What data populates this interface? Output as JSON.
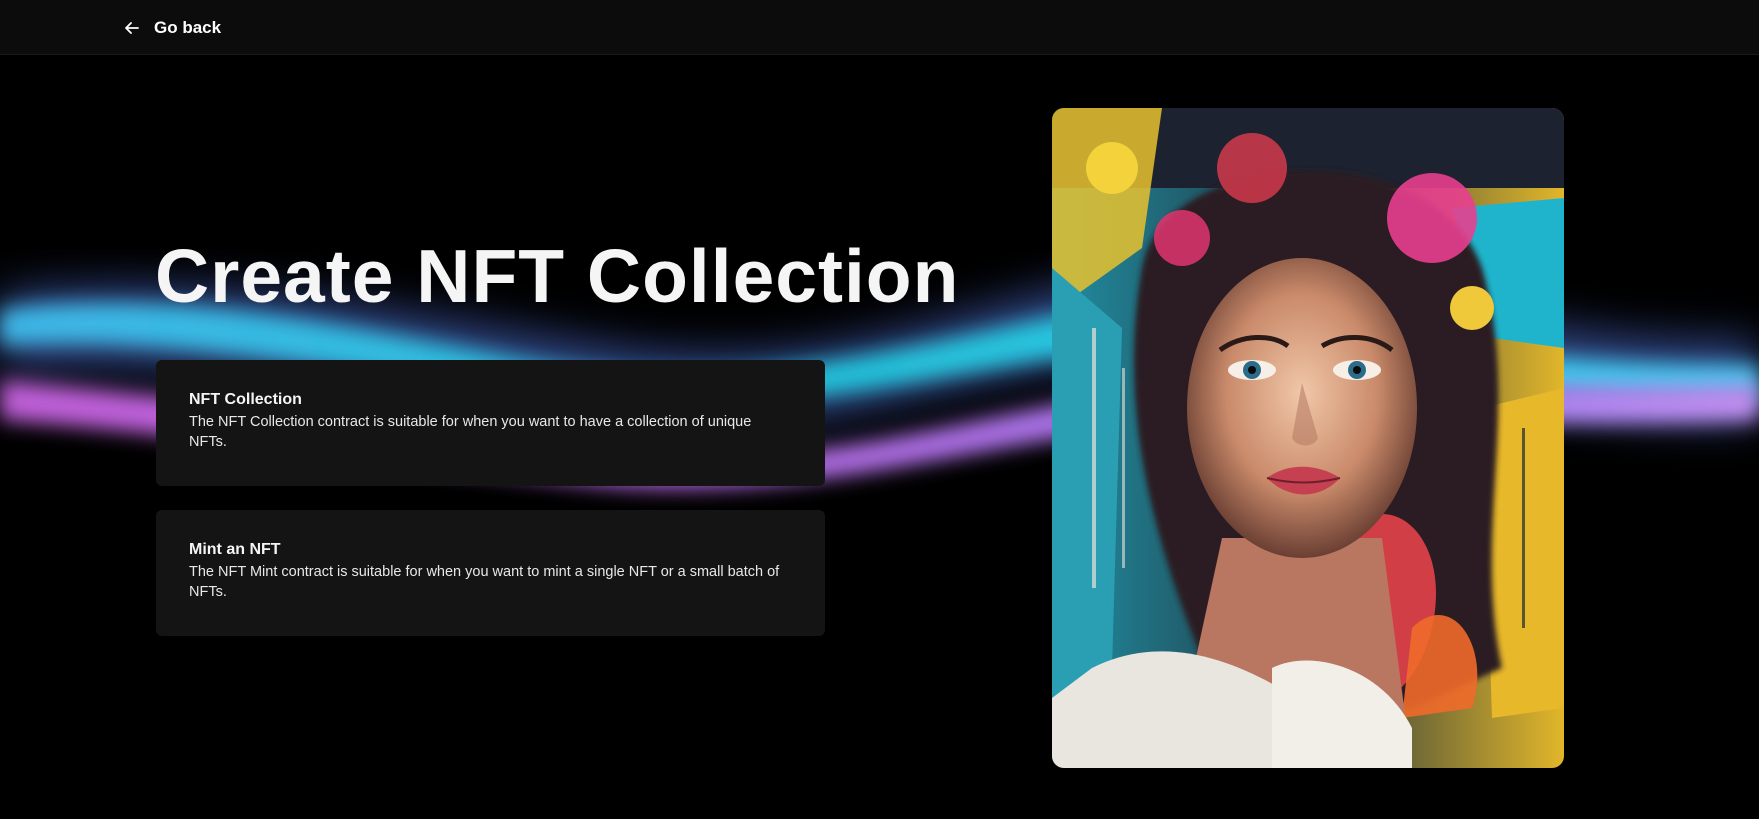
{
  "nav": {
    "back_label": "Go back",
    "back_icon": "arrow-left-icon"
  },
  "hero": {
    "title": "Create NFT Collection"
  },
  "options": [
    {
      "title": "NFT Collection",
      "description": "The NFT Collection contract is suitable for when you want to have a collection of unique NFTs."
    },
    {
      "title": "Mint an NFT",
      "description": "The NFT Mint contract is suitable for when you want to mint a single NFT or a small batch of NFTs."
    }
  ],
  "artwork": {
    "subject": "colorful-paint-splash-portrait"
  },
  "theme": {
    "background": "#000000",
    "card": "#141414",
    "wave_cyan": "#2ec9e6",
    "wave_violet": "#b86be6",
    "wave_blue": "#5a7ff0"
  }
}
